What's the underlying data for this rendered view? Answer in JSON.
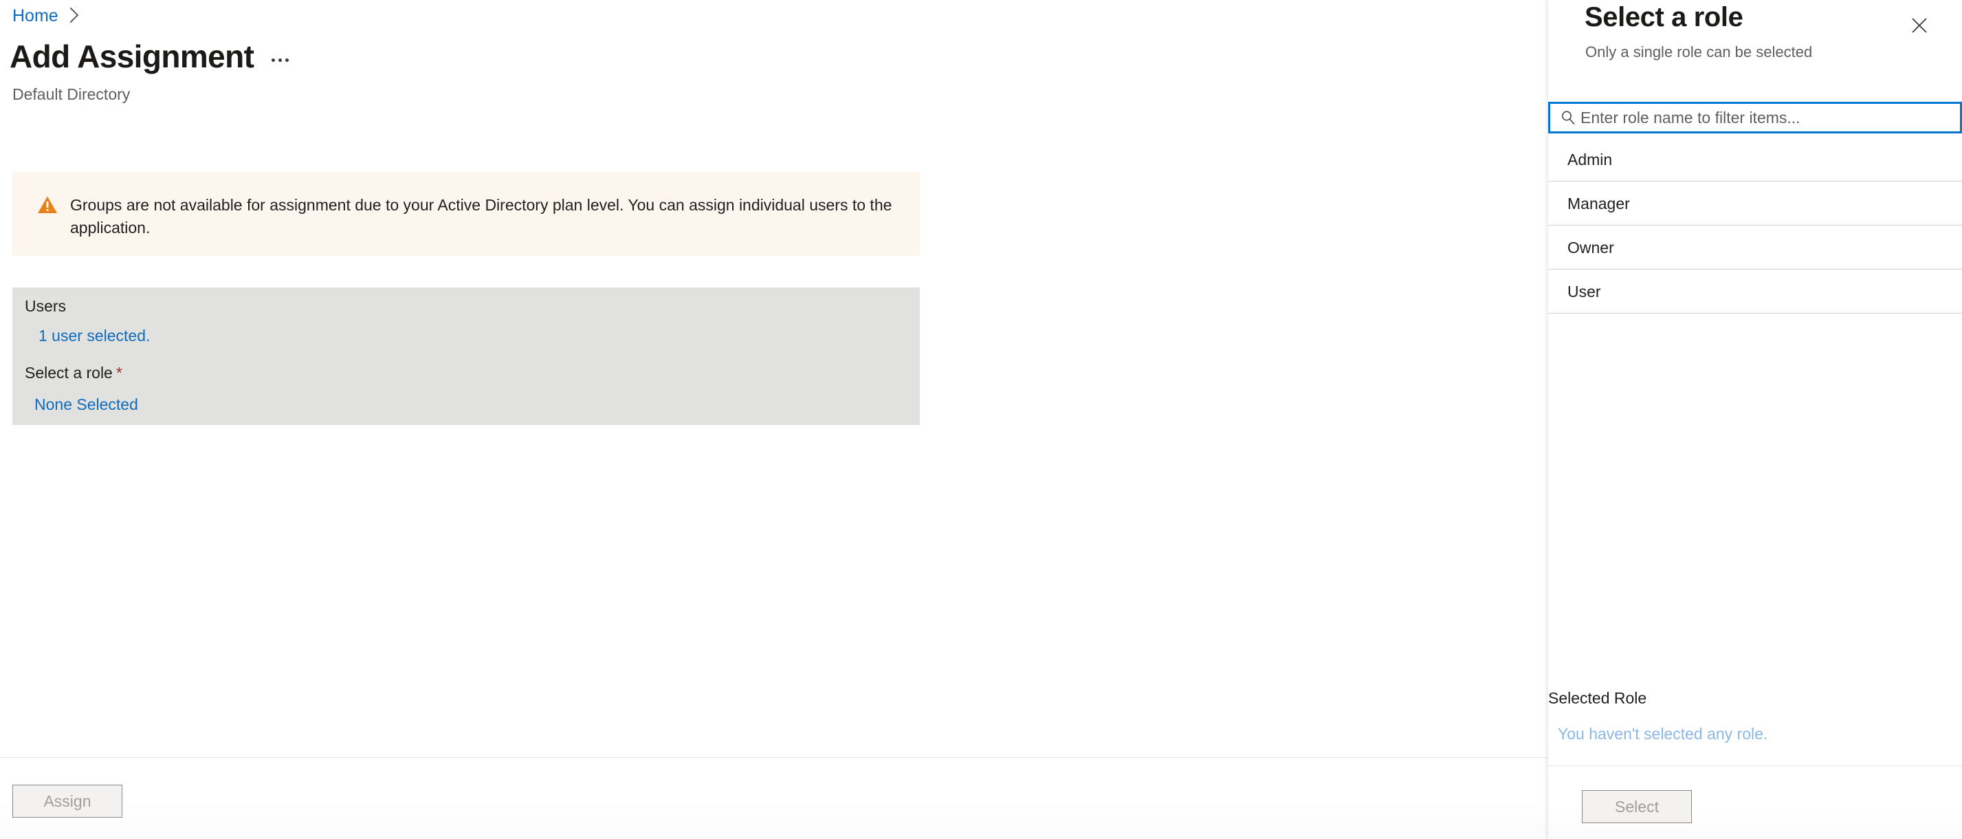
{
  "breadcrumb": {
    "home_label": "Home",
    "chevron_icon": "chevron-right-icon"
  },
  "header": {
    "title": "Add Assignment",
    "subtitle": "Default Directory",
    "more_actions_icon": "ellipsis-icon"
  },
  "warning": {
    "icon": "warning-triangle-icon",
    "icon_color": "#e8821a",
    "background_color": "#fdf6ef",
    "text": "Groups are not available for assignment due to your Active Directory plan level. You can assign individual users to the application."
  },
  "form": {
    "background_color": "#e1e1e0",
    "users_label": "Users",
    "users_value": "1 user selected.",
    "role_label": "Select a role",
    "role_required_marker": "*",
    "role_value": "None Selected",
    "link_color": "#0f6cbd",
    "required_color": "#a4262c"
  },
  "commandbar": {
    "assign_label": "Assign",
    "assign_enabled": false
  },
  "pane": {
    "title": "Select a role",
    "subtitle": "Only a single role can be selected",
    "close_icon": "close-icon",
    "search": {
      "icon": "search-icon",
      "placeholder": "Enter role name to filter items...",
      "value": "",
      "focus_border_color": "#0078d4"
    },
    "roles": [
      {
        "label": "Admin"
      },
      {
        "label": "Manager"
      },
      {
        "label": "Owner"
      },
      {
        "label": "User"
      }
    ],
    "selected_role": {
      "heading": "Selected Role",
      "empty_text": "You haven't selected any role.",
      "empty_text_color": "#8bb8e8"
    },
    "select_button_label": "Select",
    "select_button_enabled": false
  }
}
